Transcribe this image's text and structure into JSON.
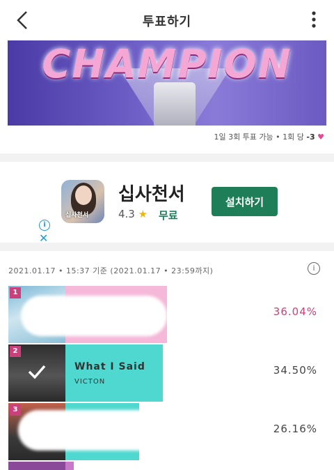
{
  "header": {
    "title": "투표하기"
  },
  "banner": {
    "text": "CHAMPION"
  },
  "vote_info": {
    "prefix": "1일 3회 투표 가능 • 1회 당",
    "count": "-3"
  },
  "ad": {
    "app_name": "십사천서",
    "rating": "4.3",
    "price": "무료",
    "install_label": "설치하기",
    "icon_caption": "십사천서"
  },
  "ranking": {
    "time_range": "2021.01.17 • 15:37 기준 (2021.01.17 • 23:59까지)",
    "rows": [
      {
        "rank": "1",
        "song": "",
        "artist": "",
        "percent": "36.04%",
        "share": 0.3604,
        "bar_color": "#f5b8d8",
        "pct_color": "#c9407a"
      },
      {
        "rank": "2",
        "song": "What I Said",
        "artist": "VICTON",
        "percent": "34.50%",
        "share": 0.345,
        "bar_color": "#4fd8cf",
        "pct_color": "#444444"
      },
      {
        "rank": "3",
        "song": "",
        "artist": "",
        "percent": "26.16%",
        "share": 0.2616,
        "bar_color": "#4fd8cf",
        "pct_color": "#444444"
      }
    ]
  },
  "colors": {
    "accent": "#c9407a",
    "install_green": "#1e7e57",
    "bar_teal": "#4fd8cf",
    "bar_pink": "#f5b8d8"
  }
}
